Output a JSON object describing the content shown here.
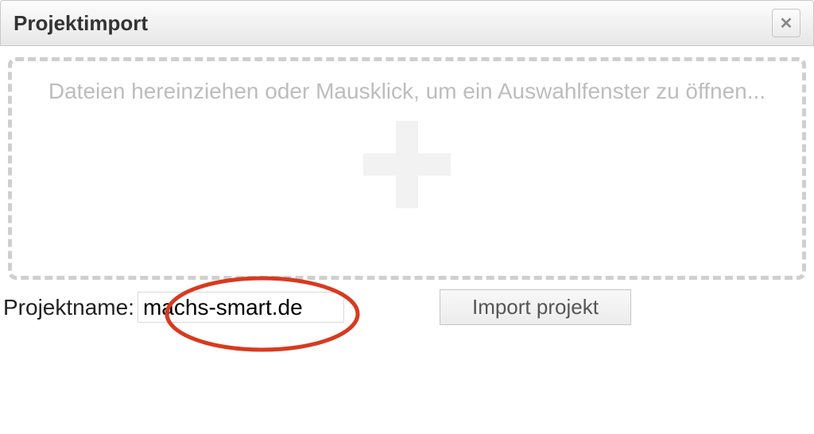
{
  "dialog": {
    "title": "Projektimport",
    "close_label": "✕"
  },
  "dropzone": {
    "text": "Dateien hereinziehen oder Mausklick, um ein Auswahlfenster zu öffnen..."
  },
  "form": {
    "projectname_label": "Projektname:",
    "projectname_value": "machs-smart.de",
    "import_button": "Import projekt"
  },
  "colors": {
    "annotation_stroke": "#d83a1f"
  }
}
